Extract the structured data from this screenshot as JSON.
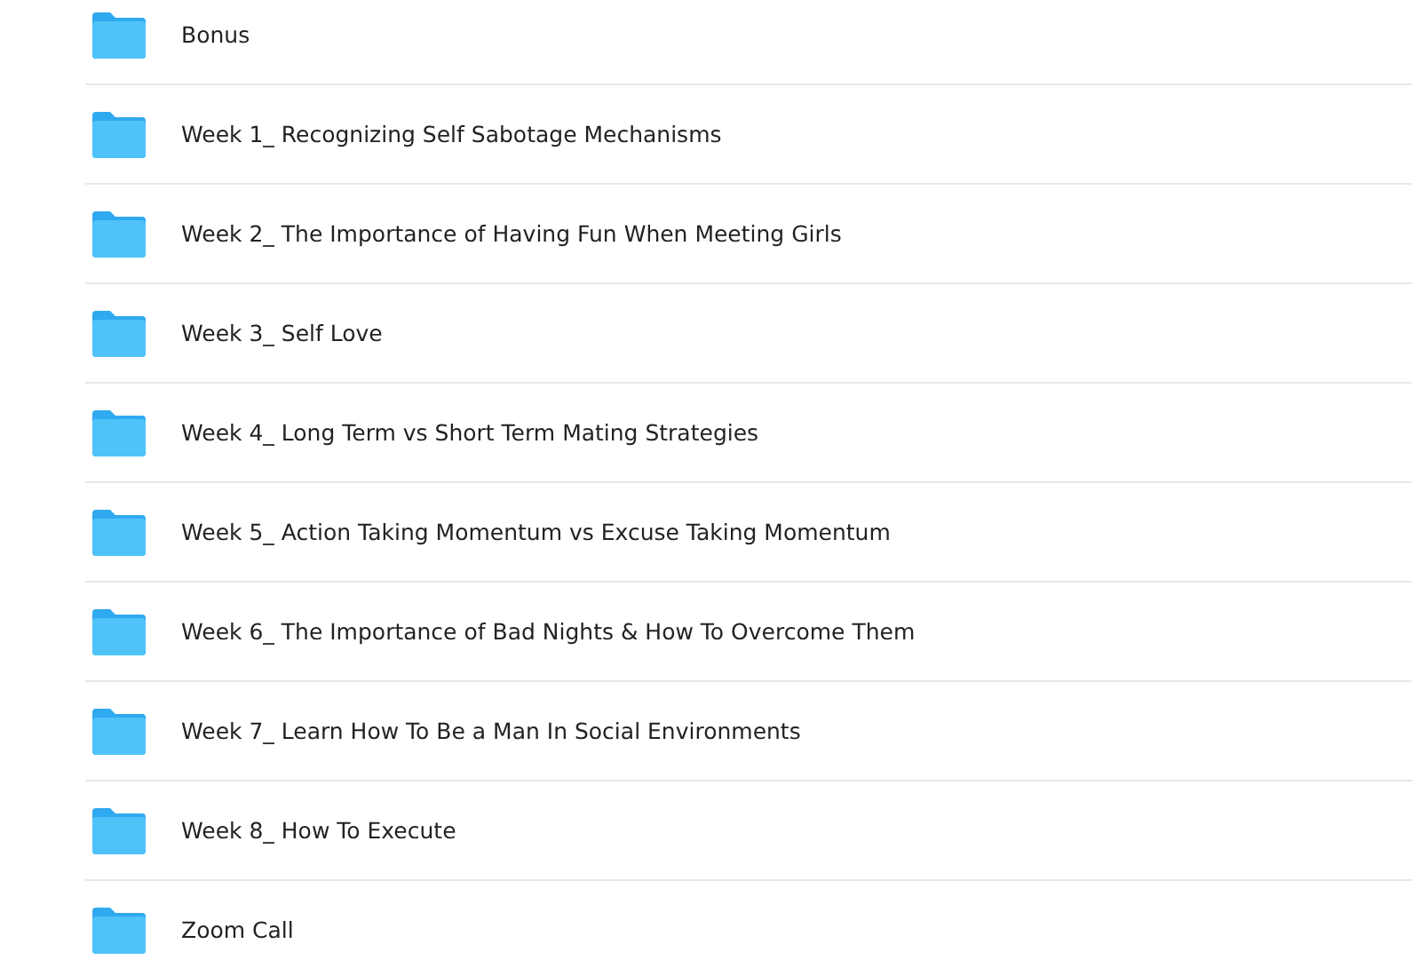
{
  "folders": [
    {
      "name": "Bonus"
    },
    {
      "name": "Week 1_ Recognizing Self Sabotage Mechanisms"
    },
    {
      "name": "Week 2_ The Importance of Having Fun When Meeting Girls"
    },
    {
      "name": "Week 3_ Self Love"
    },
    {
      "name": "Week 4_ Long Term vs Short Term Mating Strategies"
    },
    {
      "name": "Week 5_ Action Taking Momentum vs Excuse Taking Momentum"
    },
    {
      "name": "Week 6_ The Importance of Bad Nights & How To Overcome Them"
    },
    {
      "name": "Week 7_ Learn How To Be a Man In Social Environments"
    },
    {
      "name": "Week 8_ How To Execute"
    },
    {
      "name": "Zoom Call"
    }
  ]
}
